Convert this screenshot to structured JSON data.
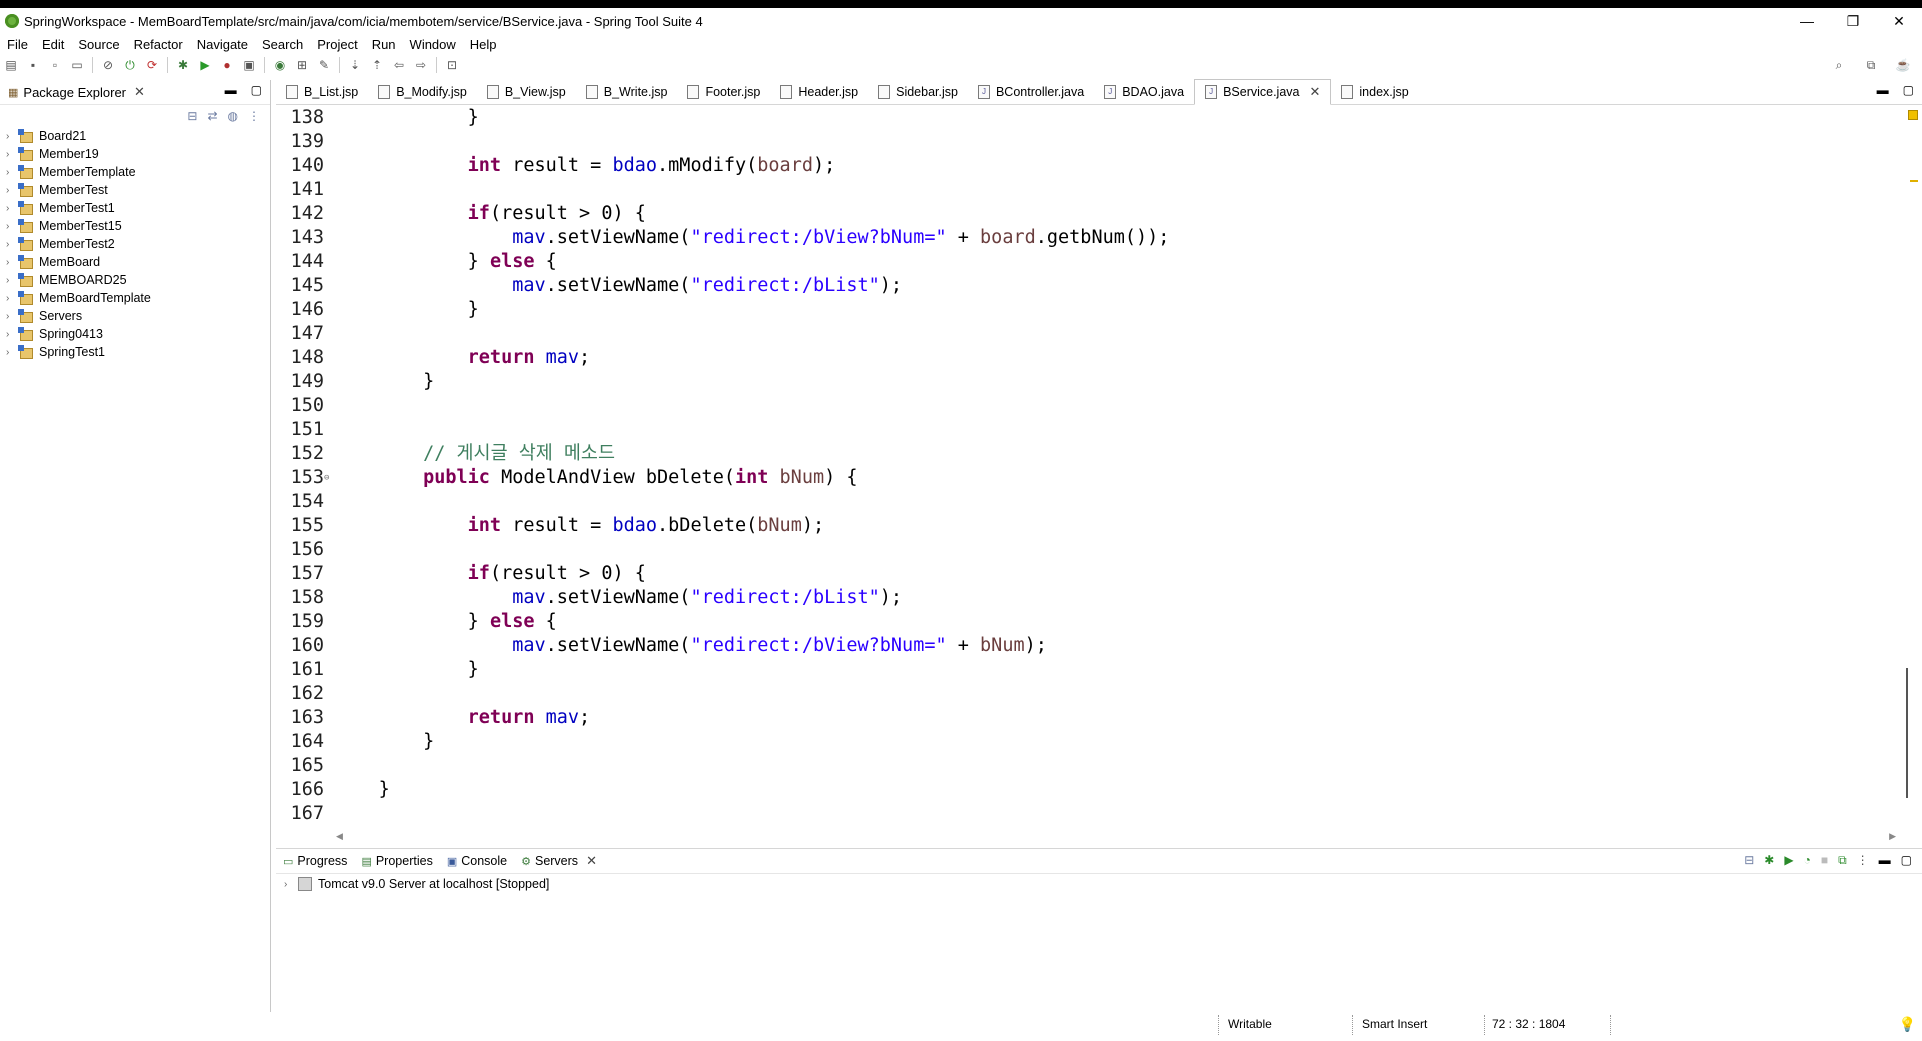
{
  "window": {
    "title": "SpringWorkspace - MemBoardTemplate/src/main/java/com/icia/membotem/service/BService.java - Spring Tool Suite 4",
    "minimize": "—",
    "maximize": "❐",
    "close": "✕"
  },
  "menu": [
    "File",
    "Edit",
    "Source",
    "Refactor",
    "Navigate",
    "Search",
    "Project",
    "Run",
    "Window",
    "Help"
  ],
  "package_explorer": {
    "title": "Package Explorer",
    "projects": [
      "Board21",
      "Member19",
      "MemberTemplate",
      "MemberTest",
      "MemberTest1",
      "MemberTest15",
      "MemberTest2",
      "MemBoard",
      "MEMBOARD25",
      "MemBoardTemplate",
      "Servers",
      "Spring0413",
      "SpringTest1"
    ]
  },
  "editor": {
    "tabs": [
      "B_List.jsp",
      "B_Modify.jsp",
      "B_View.jsp",
      "B_Write.jsp",
      "Footer.jsp",
      "Header.jsp",
      "Sidebar.jsp",
      "BController.java",
      "BDAO.java",
      "BService.java",
      "index.jsp"
    ],
    "active_tab": "BService.java",
    "lines": [
      {
        "n": "138",
        "indent": "        ",
        "t": [
          [
            "}",
            ""
          ]
        ]
      },
      {
        "n": "139",
        "indent": "",
        "t": []
      },
      {
        "n": "140",
        "indent": "        ",
        "t": [
          [
            "int",
            "kw"
          ],
          [
            " result = ",
            ""
          ],
          [
            "bdao",
            "fld"
          ],
          [
            ".mModify(",
            ""
          ],
          [
            "board",
            "var"
          ],
          [
            ");",
            ""
          ]
        ]
      },
      {
        "n": "141",
        "indent": "",
        "t": []
      },
      {
        "n": "142",
        "indent": "        ",
        "t": [
          [
            "if",
            "kw"
          ],
          [
            "(result > 0) {",
            ""
          ]
        ]
      },
      {
        "n": "143",
        "indent": "            ",
        "t": [
          [
            "mav",
            "fld"
          ],
          [
            ".setViewName(",
            ""
          ],
          [
            "\"redirect:/bView?bNum=\"",
            "str"
          ],
          [
            " + ",
            ""
          ],
          [
            "board",
            "var"
          ],
          [
            ".getbNum());",
            ""
          ]
        ]
      },
      {
        "n": "144",
        "indent": "        ",
        "t": [
          [
            "} ",
            ""
          ],
          [
            "else",
            "kw"
          ],
          [
            " {",
            ""
          ]
        ]
      },
      {
        "n": "145",
        "indent": "            ",
        "t": [
          [
            "mav",
            "fld"
          ],
          [
            ".setViewName(",
            ""
          ],
          [
            "\"redirect:/bList\"",
            "str"
          ],
          [
            ");",
            ""
          ]
        ]
      },
      {
        "n": "146",
        "indent": "        ",
        "t": [
          [
            "}",
            ""
          ]
        ]
      },
      {
        "n": "147",
        "indent": "",
        "t": []
      },
      {
        "n": "148",
        "indent": "        ",
        "t": [
          [
            "return",
            "kw"
          ],
          [
            " ",
            ""
          ],
          [
            "mav",
            "fld"
          ],
          [
            ";",
            ""
          ]
        ]
      },
      {
        "n": "149",
        "indent": "    ",
        "t": [
          [
            "}",
            ""
          ]
        ]
      },
      {
        "n": "150",
        "indent": "",
        "t": []
      },
      {
        "n": "151",
        "indent": "",
        "t": []
      },
      {
        "n": "152",
        "indent": "    ",
        "t": [
          [
            "// 게시글 삭제 메소드",
            "cmt"
          ]
        ]
      },
      {
        "n": "153",
        "indent": "    ",
        "fold": "⊖",
        "t": [
          [
            "public",
            "kw"
          ],
          [
            " ModelAndView bDelete(",
            ""
          ],
          [
            "int",
            "kw"
          ],
          [
            " ",
            ""
          ],
          [
            "bNum",
            "var"
          ],
          [
            ") {",
            ""
          ]
        ]
      },
      {
        "n": "154",
        "indent": "",
        "t": []
      },
      {
        "n": "155",
        "indent": "        ",
        "t": [
          [
            "int",
            "kw"
          ],
          [
            " result = ",
            ""
          ],
          [
            "bdao",
            "fld"
          ],
          [
            ".bDelete(",
            ""
          ],
          [
            "bNum",
            "var"
          ],
          [
            ");",
            ""
          ]
        ]
      },
      {
        "n": "156",
        "indent": "",
        "t": []
      },
      {
        "n": "157",
        "indent": "        ",
        "t": [
          [
            "if",
            "kw"
          ],
          [
            "(result > 0) {",
            ""
          ]
        ]
      },
      {
        "n": "158",
        "indent": "            ",
        "t": [
          [
            "mav",
            "fld"
          ],
          [
            ".setViewName(",
            ""
          ],
          [
            "\"redirect:/bList\"",
            "str"
          ],
          [
            ");",
            ""
          ]
        ]
      },
      {
        "n": "159",
        "indent": "        ",
        "t": [
          [
            "} ",
            ""
          ],
          [
            "else",
            "kw"
          ],
          [
            " {",
            ""
          ]
        ]
      },
      {
        "n": "160",
        "indent": "            ",
        "t": [
          [
            "mav",
            "fld"
          ],
          [
            ".setViewName(",
            ""
          ],
          [
            "\"redirect:/bView?bNum=\"",
            "str"
          ],
          [
            " + ",
            ""
          ],
          [
            "bNum",
            "var"
          ],
          [
            ");",
            ""
          ]
        ]
      },
      {
        "n": "161",
        "indent": "        ",
        "t": [
          [
            "}",
            ""
          ]
        ]
      },
      {
        "n": "162",
        "indent": "",
        "t": []
      },
      {
        "n": "163",
        "indent": "        ",
        "t": [
          [
            "return",
            "kw"
          ],
          [
            " ",
            ""
          ],
          [
            "mav",
            "fld"
          ],
          [
            ";",
            ""
          ]
        ]
      },
      {
        "n": "164",
        "indent": "    ",
        "t": [
          [
            "}",
            ""
          ]
        ]
      },
      {
        "n": "165",
        "indent": "",
        "t": []
      },
      {
        "n": "166",
        "indent": "",
        "t": [
          [
            "}",
            ""
          ]
        ]
      },
      {
        "n": "167",
        "indent": "",
        "t": []
      }
    ]
  },
  "bottom_panel": {
    "tabs": [
      "Progress",
      "Properties",
      "Console",
      "Servers"
    ],
    "active_tab": "Servers",
    "server_entry": "Tomcat v9.0 Server at localhost  [Stopped]"
  },
  "status": {
    "writable": "Writable",
    "insert_mode": "Smart Insert",
    "position": "72 : 32 : 1804"
  }
}
